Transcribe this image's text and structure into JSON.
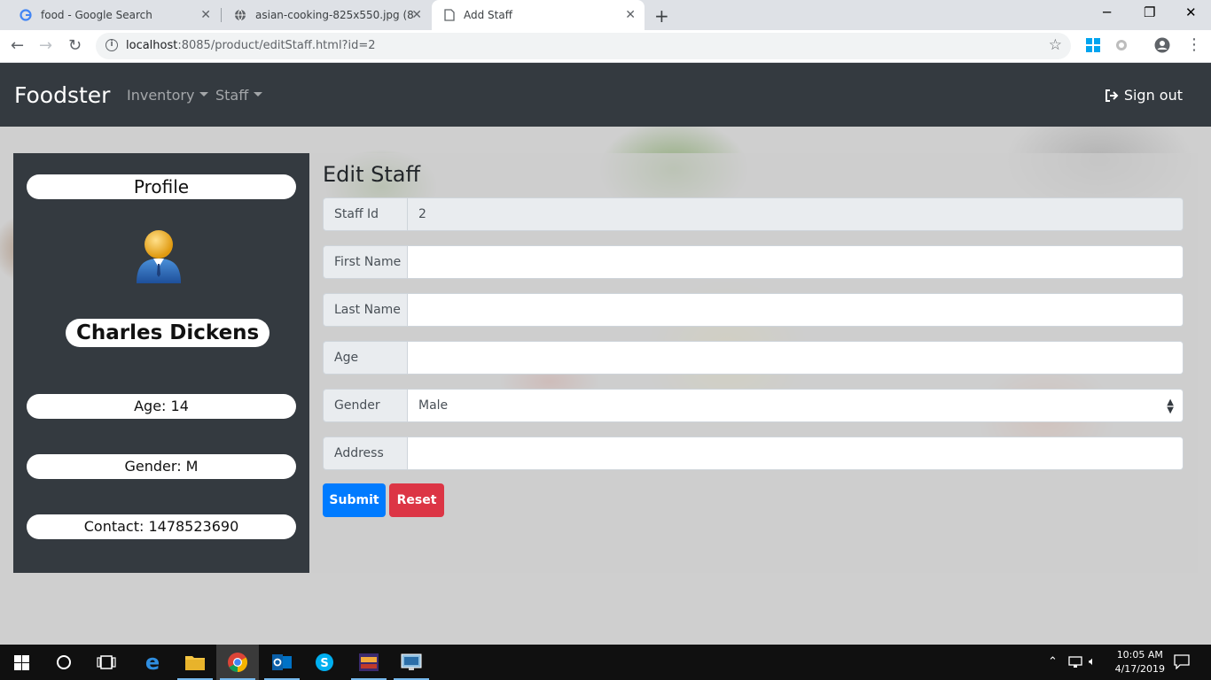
{
  "browser": {
    "tabs": [
      {
        "title": "food - Google Search",
        "active": false
      },
      {
        "title": "asian-cooking-825x550.jpg (825×",
        "active": false
      },
      {
        "title": "Add Staff",
        "active": true
      }
    ],
    "url_host": "localhost",
    "url_path": ":8085/product/editStaff.html?id=2"
  },
  "navbar": {
    "brand": "Foodster",
    "menus": [
      {
        "label": "Inventory"
      },
      {
        "label": "Staff"
      }
    ],
    "signout": "Sign out"
  },
  "profile": {
    "heading": "Profile",
    "name": "Charles Dickens",
    "age": "Age: 14",
    "gender": "Gender: M",
    "contact": "Contact: 1478523690"
  },
  "form": {
    "title": "Edit Staff",
    "fields": {
      "staff_id": {
        "label": "Staff Id",
        "value": "2"
      },
      "first_name": {
        "label": "First Name",
        "value": ""
      },
      "last_name": {
        "label": "Last Name",
        "value": ""
      },
      "age": {
        "label": "Age",
        "value": ""
      },
      "gender": {
        "label": "Gender",
        "value": "Male"
      },
      "address": {
        "label": "Address",
        "value": ""
      }
    },
    "submit": "Submit",
    "reset": "Reset"
  },
  "taskbar": {
    "time": "10:05 AM",
    "date": "4/17/2019"
  },
  "colors": {
    "navbar": "#343a40",
    "primary": "#007bff",
    "danger": "#dc3545"
  }
}
